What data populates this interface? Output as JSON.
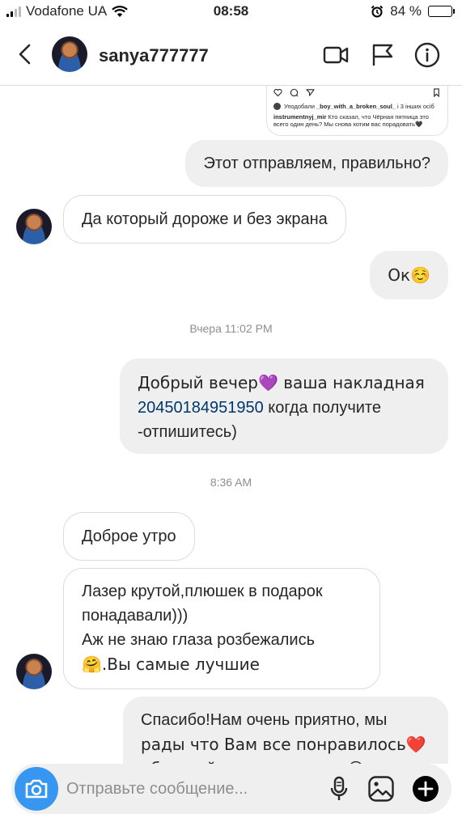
{
  "status_bar": {
    "carrier": "Vodafone UA",
    "time": "08:58",
    "battery": "84 %",
    "battery_level": 0.84
  },
  "header": {
    "username": "sanya777777"
  },
  "shared_post": {
    "likes_text_prefix": "Уподобали ",
    "likes_user": "_boy_with_a_broken_soul_",
    "likes_text_suffix": " і 3 інших осіб",
    "caption_user": "instrumentnyj_mir",
    "caption_text": " Кто сказал, что Чёрная пятница это всего один день? Мы снова хотим вас порадовать🖤"
  },
  "messages": [
    {
      "id": "m1",
      "text": "Этот отправляем, правильно?"
    },
    {
      "id": "m2",
      "text": "Да который дороже и без экрана"
    },
    {
      "id": "m3",
      "text": "Ок☺️"
    },
    {
      "id": "ts1",
      "text": "Вчера 11:02 PM"
    },
    {
      "id": "m4",
      "text_a": "Добрый вечер💜 ваша накладная",
      "link": "20450184951950",
      "text_b": " когда получите",
      "text_c": "-отпишитесь)"
    },
    {
      "id": "ts2",
      "text": "8:36 AM"
    },
    {
      "id": "m5",
      "text": "Доброе утро"
    },
    {
      "id": "m6",
      "line1": "Лазер крутой,плюшек в подарок",
      "line2": "понадавали)))",
      "line3": "Аж не знаю глаза розбежались",
      "line4": "🤗.Вы самые лучшие"
    },
    {
      "id": "m7",
      "line1": "Спасибо!Нам очень приятно, мы",
      "line2": "рады что Вам все понравилось❤️",
      "line3": "обращайтесь к нам еще😊"
    }
  ],
  "composer": {
    "placeholder": "Отправьте сообщение..."
  },
  "icons": {
    "back": "chevron-left-icon",
    "video": "video-call-icon",
    "flag": "flag-icon",
    "info": "info-icon",
    "camera": "camera-icon",
    "mic": "microphone-icon",
    "gallery": "gallery-icon",
    "add": "plus-circle-icon"
  },
  "colors": {
    "accent": "#3797f0",
    "link": "#00376b",
    "outgoing_bubble": "#efefef",
    "timestamp": "#8e8e8e"
  }
}
